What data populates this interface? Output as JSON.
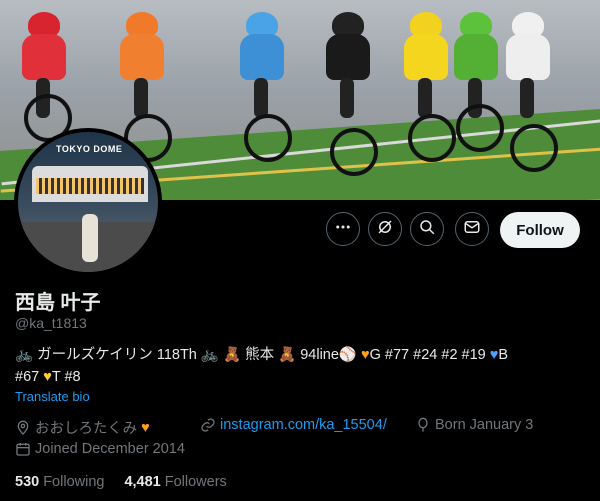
{
  "banner": {
    "dome_label": "TOKYO DOME"
  },
  "profile": {
    "display_name": "西島 叶子",
    "handle": "@ka_t1813",
    "bio_line1_part1": "ガールズケイリン 118Th",
    "bio_line1_part2": "熊本",
    "bio_line1_part3": "94line",
    "bio_line1_part4": "G #77 #24 #2 #19",
    "bio_line1_part5": "B",
    "bio_line2_part1": "#67",
    "bio_line2_part2": "T #8",
    "translate_label": "Translate bio",
    "location": "おおしろたくみ",
    "website": "instagram.com/ka_15504/",
    "birthday": "Born January 3",
    "joined": "Joined December 2014"
  },
  "actions": {
    "follow_label": "Follow"
  },
  "stats": {
    "following_count": "530",
    "following_label": "Following",
    "followers_count": "4,481",
    "followers_label": "Followers"
  },
  "colors": {
    "accent": "#1d9bf0",
    "muted": "#71767b",
    "text": "#e7e9ea",
    "follow_bg": "#eff3f4"
  },
  "icons": [
    "more-icon",
    "grok-icon",
    "search-icon",
    "message-icon",
    "location-icon",
    "link-icon",
    "balloon-icon",
    "calendar-icon"
  ]
}
